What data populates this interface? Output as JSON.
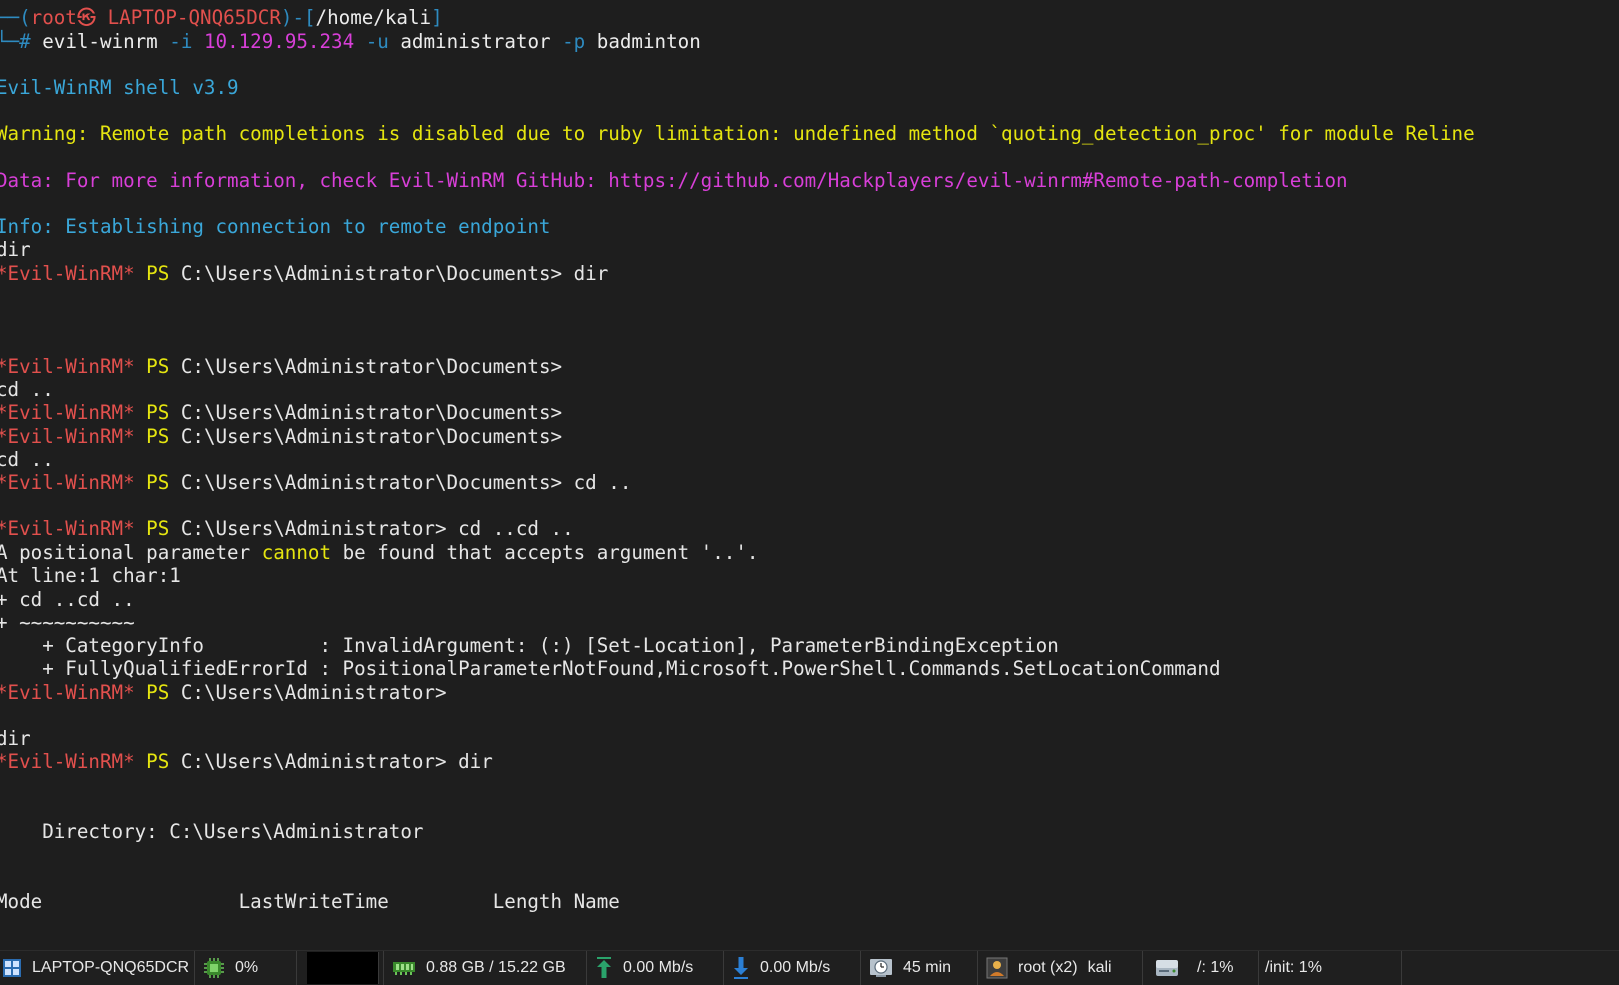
{
  "terminal": {
    "line1": {
      "p1": "──(",
      "user": "root㉿ LAPTOP-QNQ65DCR",
      "p2": ")-[",
      "path": "/home/kali",
      "p3": "]"
    },
    "line2": {
      "p1": "└─# ",
      "cmd": "evil-winrm",
      "f1": " -i ",
      "ip": "10.129.95.234",
      "f2": " -u ",
      "user": "administrator",
      "f3": " -p ",
      "pw": "badminton"
    },
    "banner": "Evil-WinRM shell v3.9",
    "warning": "Warning: Remote path completions is disabled due to ruby limitation: undefined method `quoting_detection_proc' for module Reline",
    "data_msg": "Data: For more information, check Evil-WinRM GitHub: https://github.com/Hackplayers/evil-winrm#Remote-path-completion",
    "info": "Info: Establishing connection to remote endpoint",
    "prompt_prefix": "*Evil-WinRM*",
    "ps": " PS ",
    "path_docs": "C:\\Users\\Administrator\\Documents>",
    "path_admin": "C:\\Users\\Administrator>",
    "t_dir": "dir",
    "cmd_dir": " dir",
    "t_cd": "cd ..",
    "cmd_cd": " cd ..",
    "cmd_cdcd": " cd ..cd ..",
    "err1a": "A positional parameter ",
    "err1b": "cannot",
    "err1c": " be found that accepts argument '..'.",
    "err2": "At line:1 char:1",
    "err3": "+ cd ..cd ..",
    "err4": "+ ~~~~~~~~~~",
    "err5": "    + CategoryInfo          : InvalidArgument: (:) [Set-Location], ParameterBindingException",
    "err6": "    + FullyQualifiedErrorId : PositionalParameterNotFound,Microsoft.PowerShell.Commands.SetLocationCommand",
    "directory": "    Directory: C:\\Users\\Administrator",
    "headers": "Mode                 LastWriteTime         Length Name"
  },
  "statusbar": {
    "host": "LAPTOP-QNQ65DCR",
    "cpu": "0%",
    "memory": "0.88 GB / 15.22 GB",
    "upload": "0.00 Mb/s",
    "download": "0.00 Mb/s",
    "uptime": "45 min",
    "session_user": "root (x2)",
    "session_name": "kali",
    "disk_root": "/: 1%",
    "disk_init": "/init: 1%"
  },
  "icons": {
    "windows": "windows-icon",
    "cpu": "cpu-chip-icon",
    "memory": "ram-icon",
    "upload": "upload-arrow-icon",
    "download": "download-arrow-icon",
    "clock": "clock-icon",
    "user": "user-icon",
    "disk": "disk-icon"
  },
  "colors": {
    "background": "#1e1e1e",
    "prompt_blue": "#2e8bc0",
    "prompt_red": "#e2504d",
    "warning_yellow": "#e5e510",
    "data_magenta": "#d83fd8",
    "info_blue": "#3aa7d9"
  }
}
